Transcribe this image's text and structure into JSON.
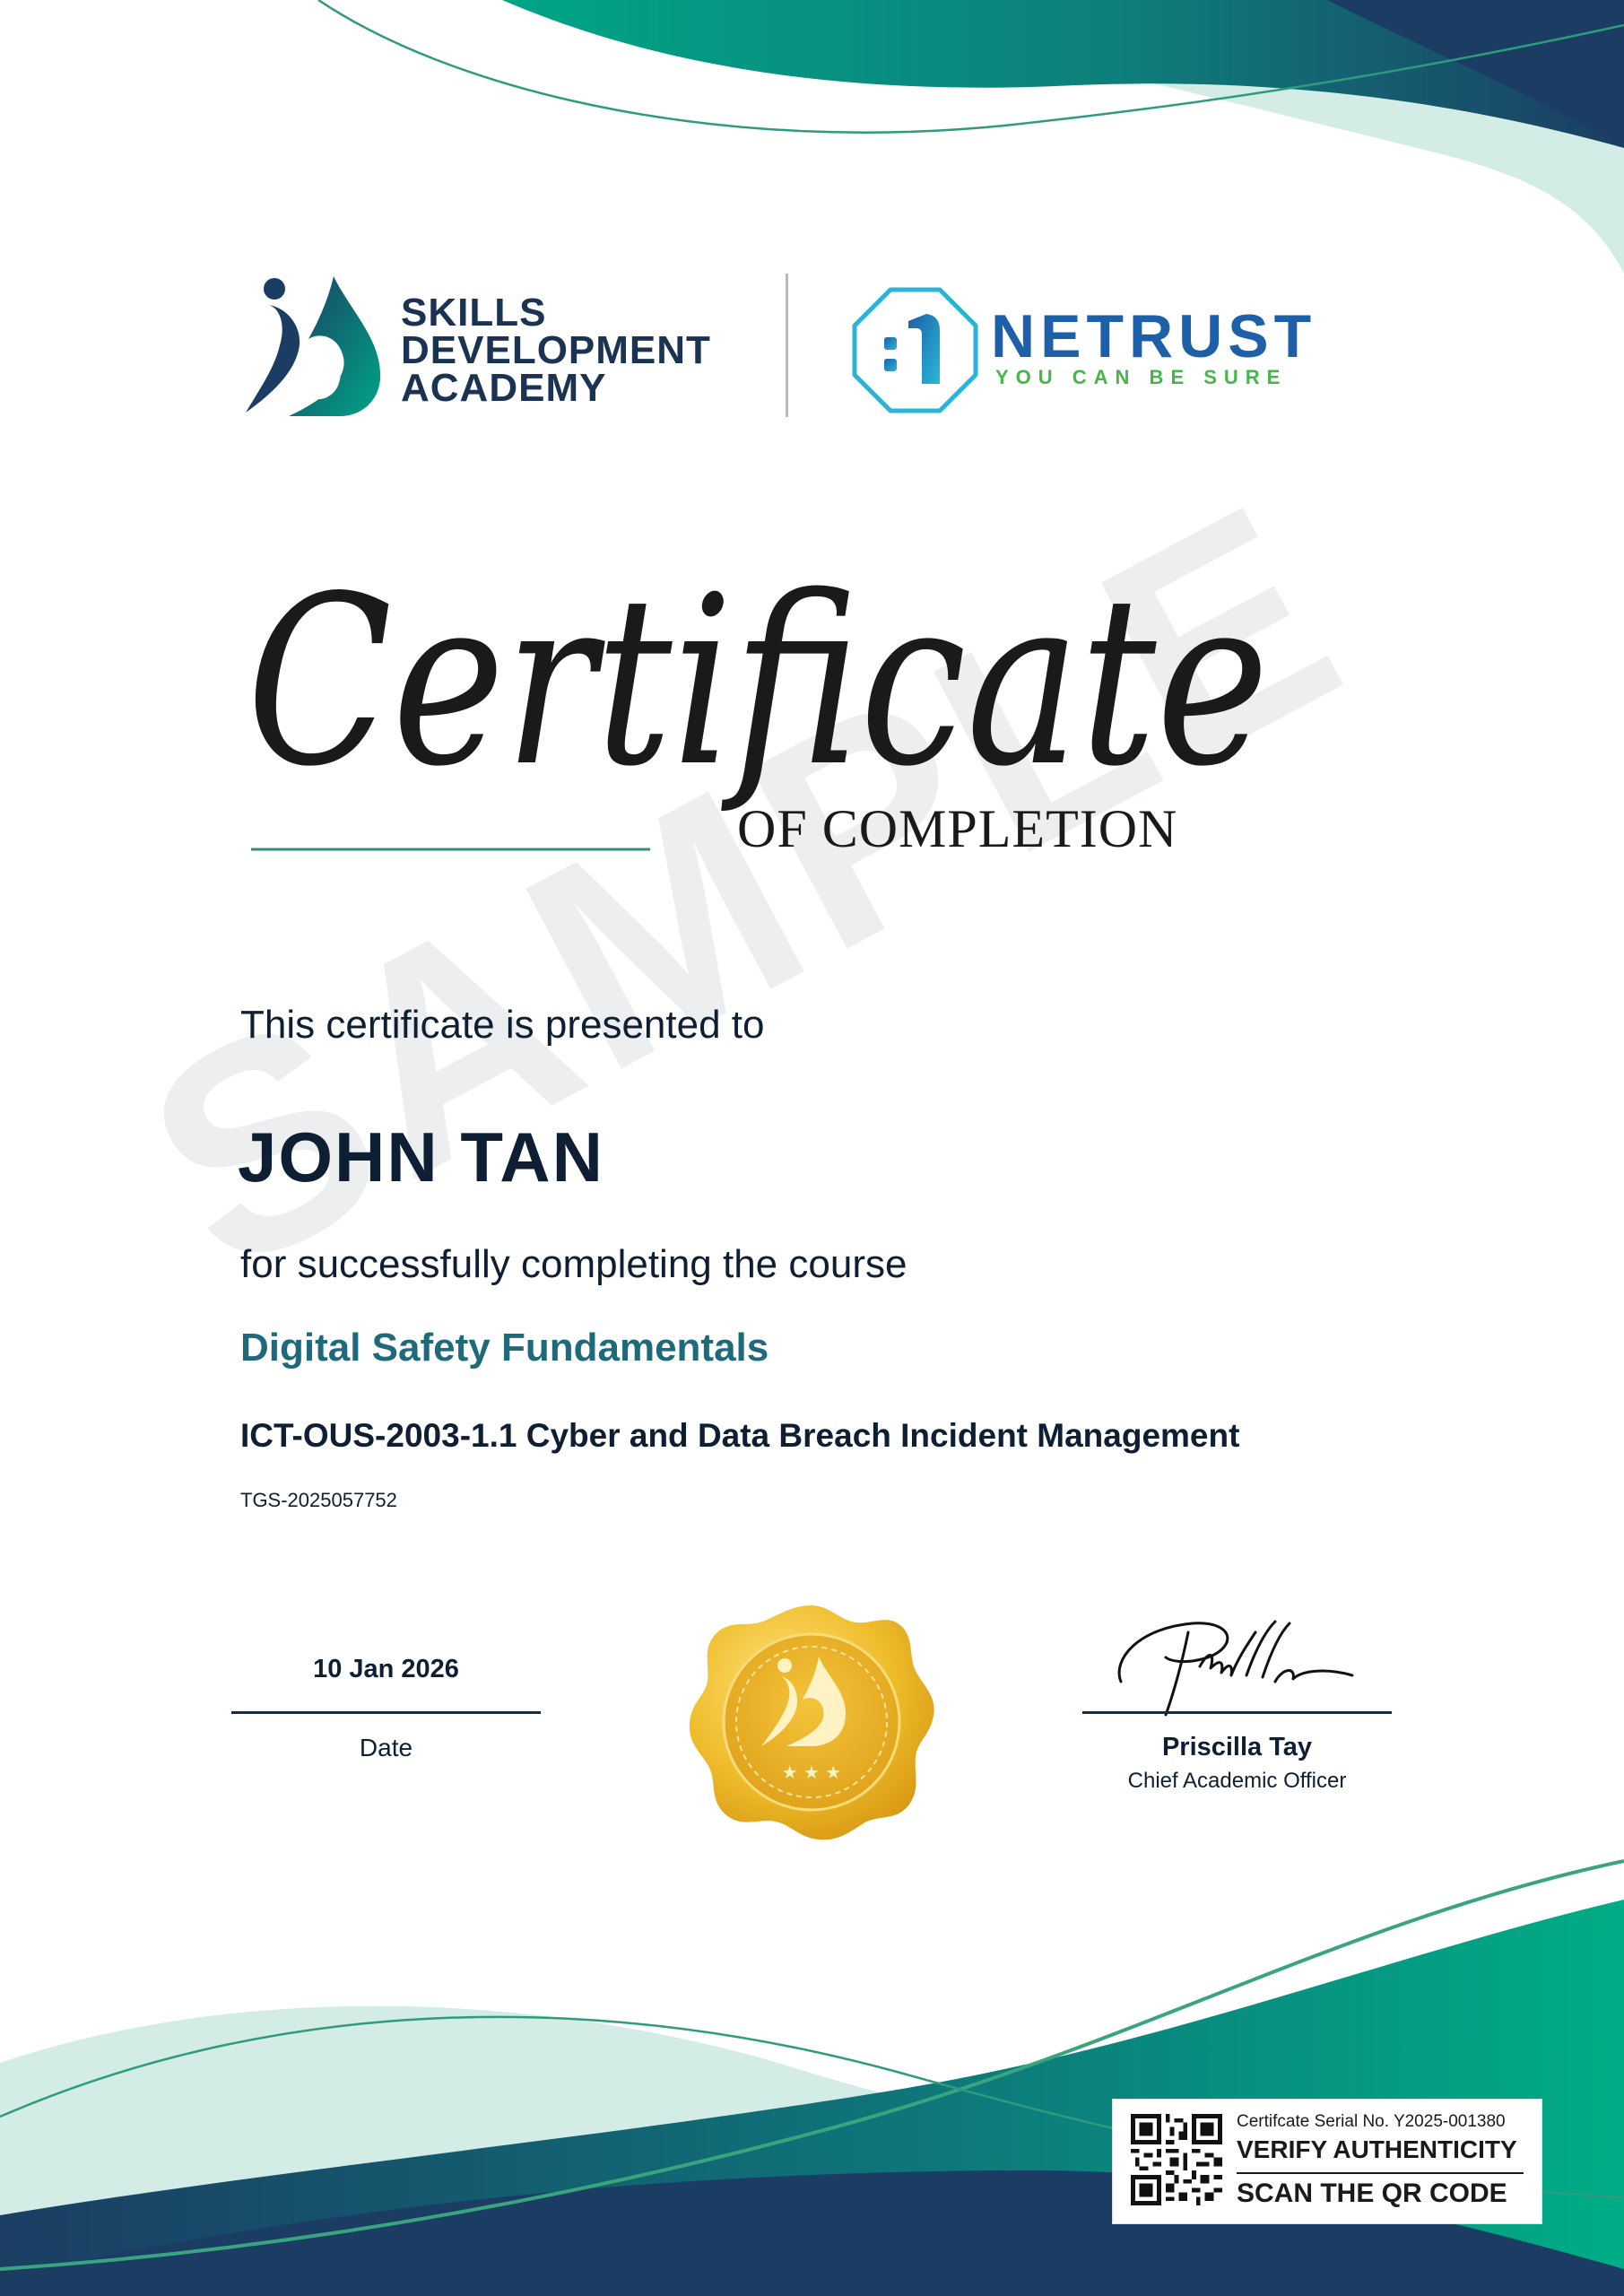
{
  "colors": {
    "navy": "#1b3d63",
    "teal": "#0d8a7e",
    "green": "#00ad85",
    "mint": "#d3ede6",
    "course_accent": "#1f6a7a",
    "gold": "#e9b423",
    "netrust_blue": "#1d5fa8",
    "netrust_green": "#47b649"
  },
  "logos": {
    "sda": {
      "icon": "sda-academy-icon",
      "lines": [
        "SKILLS",
        "DEVELOPMENT",
        "ACADEMY"
      ]
    },
    "netrust": {
      "icon": "netrust-hexagon-icon",
      "name": "NETRUST",
      "tagline": "YOU CAN BE SURE"
    }
  },
  "certificate": {
    "title": "Certificate",
    "subtitle": "OF COMPLETION",
    "watermark": "SAMPLE",
    "presented_text": "This certificate is presented to",
    "recipient": "JOHN TAN",
    "completion_text": "for successfully completing the course",
    "course": "Digital Safety Fundamentals",
    "module": "ICT-OUS-2003-1.1 Cyber and Data Breach Incident Management",
    "course_code": "TGS-2025057752"
  },
  "date": {
    "value": "10 Jan 2026",
    "label": "Date"
  },
  "seal": {
    "icon": "gold-seal-icon"
  },
  "signatory": {
    "signature_icon": "signature-icon",
    "name": "Priscilla Tay",
    "title": "Chief Academic Officer"
  },
  "verification": {
    "serial": "Certifcate Serial No. Y2025-001380",
    "verify": "VERIFY AUTHENTICITY",
    "scan": "SCAN THE QR CODE",
    "qr_icon": "qr-code-icon"
  }
}
